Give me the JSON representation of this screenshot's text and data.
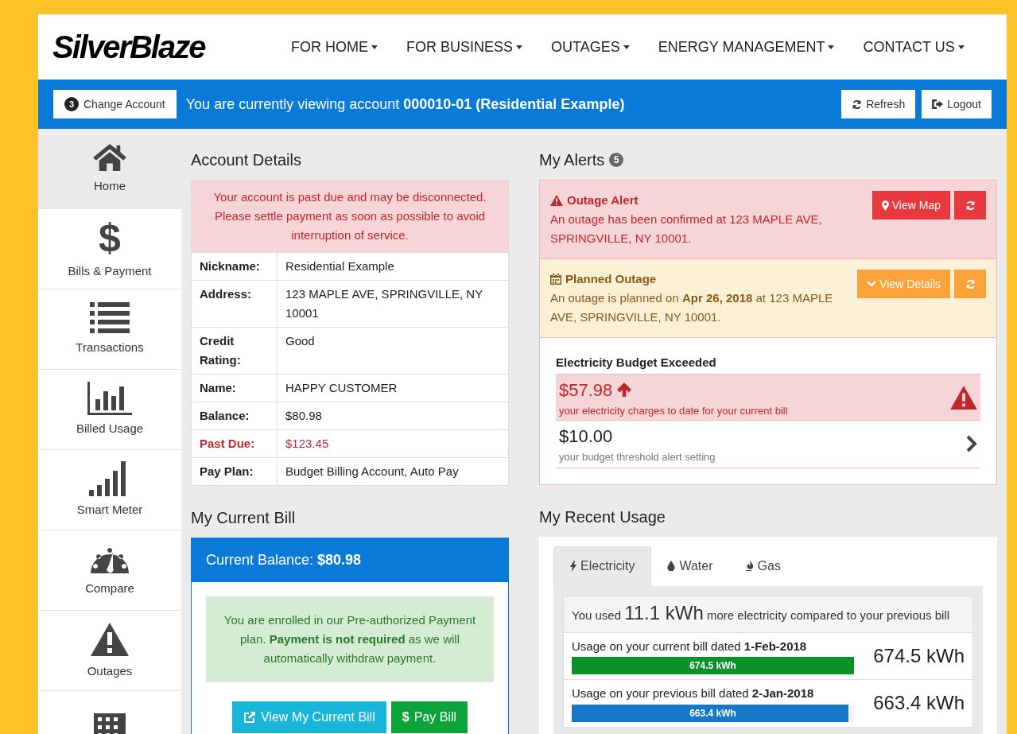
{
  "header": {
    "logo": "SilverBlaze",
    "nav": [
      {
        "label": "FOR HOME"
      },
      {
        "label": "FOR BUSINESS"
      },
      {
        "label": "OUTAGES"
      },
      {
        "label": "ENERGY MANAGEMENT"
      },
      {
        "label": "CONTACT US"
      }
    ]
  },
  "account_bar": {
    "change_account": {
      "badge": "3",
      "label": "Change Account"
    },
    "message": "You are currently viewing account **000010-01 (Residential Example)**",
    "buttons": [
      {
        "kind": "refresh",
        "label": "Refresh"
      },
      {
        "kind": "logout",
        "label": "Logout"
      }
    ]
  },
  "sidebar": {
    "items": [
      {
        "kind": "home",
        "label": "Home",
        "selected": true
      },
      {
        "kind": "dollar",
        "glyph": "$",
        "label": "Bills & Payment",
        "selected": false
      },
      {
        "kind": "list",
        "label": "Transactions",
        "selected": false
      },
      {
        "kind": "bars",
        "label": "Billed Usage",
        "selected": false
      },
      {
        "kind": "signal",
        "label": "Smart Meter",
        "selected": false
      },
      {
        "kind": "gauge",
        "label": "Compare",
        "selected": false
      },
      {
        "kind": "warning",
        "label": "Outages",
        "selected": false
      },
      {
        "kind": "building",
        "selected": false
      }
    ]
  },
  "account_details": {
    "title": "Account Details",
    "notice": "Your account is past due and may be disconnected. Please settle payment as soon as possible to avoid interruption of service.",
    "rows": [
      {
        "label": "Nickname:",
        "value": "Residential Example",
        "past_due": false
      },
      {
        "label": "Address:",
        "value": "123 MAPLE AVE, SPRINGVILLE, NY 10001",
        "past_due": false
      },
      {
        "label": "Credit Rating:",
        "value": "Good",
        "past_due": false
      },
      {
        "label": "Name:",
        "value": "HAPPY CUSTOMER",
        "past_due": false
      },
      {
        "label": "Balance:",
        "value": "$80.98",
        "past_due": false
      },
      {
        "label": "Past Due:",
        "value": "$123.45",
        "past_due": true
      },
      {
        "label": "Pay Plan:",
        "value": "Budget Billing Account, Auto Pay",
        "past_due": false
      }
    ]
  },
  "current_bill": {
    "title": "My Current Bill",
    "header": "Current Balance: **$80.98**",
    "notice": "You are enrolled in our Pre-authorized Payment plan. **Payment is not required** as we will automatically withdraw payment.",
    "buttons": [
      {
        "kind": "view",
        "label": "View My Current Bill"
      },
      {
        "kind": "pay",
        "glyph": "$",
        "label": "Pay Bill"
      }
    ]
  },
  "alerts": {
    "title": "My Alerts",
    "count": "5",
    "items": [
      {
        "kind": "danger",
        "title": "Outage Alert",
        "text": "An outage has been confirmed at 123 MAPLE AVE, SPRINGVILLE, NY 10001.",
        "button": "View Map"
      },
      {
        "kind": "warning",
        "title": "Planned Outage",
        "text": "An outage is planned on **Apr 26, 2018** at 123 MAPLE AVE, SPRINGVILLE, NY 10001.",
        "button": "View Details"
      },
      {
        "kind": "budget",
        "title": "Electricity Budget Exceeded",
        "charges": {
          "amount": "$57.98",
          "caption": "your electricity charges to date for your current bill"
        },
        "threshold": {
          "amount": "$10.00",
          "caption": "your budget threshold alert setting"
        }
      }
    ]
  },
  "recent_usage": {
    "title": "My Recent Usage",
    "tabs": [
      {
        "kind": "bolt",
        "label": "Electricity",
        "selected": true
      },
      {
        "kind": "drop",
        "label": "Water",
        "selected": false
      },
      {
        "kind": "flame",
        "label": "Gas",
        "selected": false
      }
    ],
    "summary": {
      "before": "You used",
      "amount": "11.1 kWh",
      "after": "more electricity compared to your previous bill"
    },
    "bills": [
      {
        "caption": "Usage on your current bill dated **1-Feb-2018**",
        "bar_label": "674.5 kWh",
        "level": 1,
        "color": "#0a9128",
        "total": "674.5 kWh"
      },
      {
        "caption": "Usage on your previous bill dated **2-Jan-2018**",
        "bar_label": "663.4 kWh",
        "level": 0.98,
        "color": "#1878c8",
        "total": "663.4 kWh"
      }
    ]
  }
}
